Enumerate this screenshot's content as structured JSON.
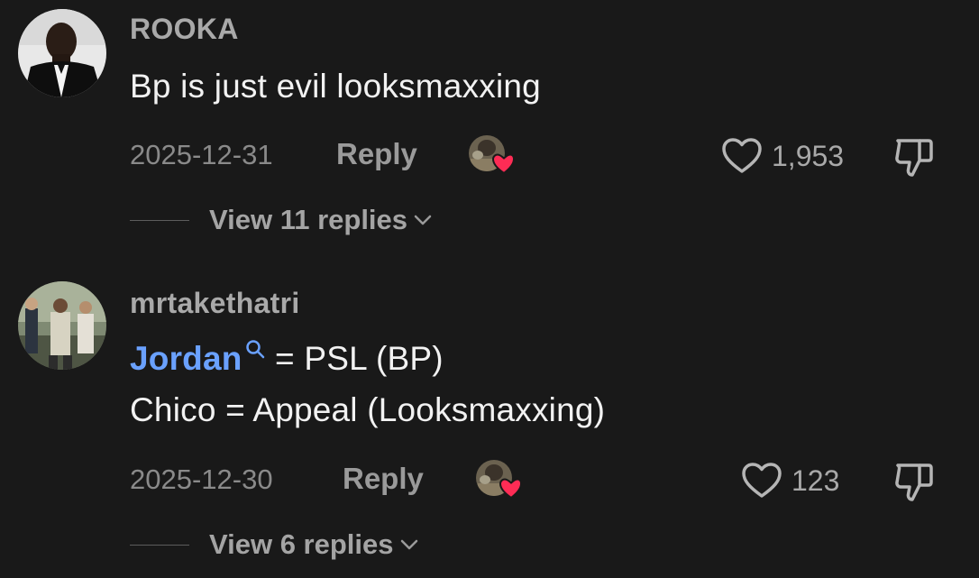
{
  "comments": [
    {
      "username": "ROOKA",
      "lines": [
        "Bp is just evil looksmaxxing"
      ],
      "date": "2025-12-31",
      "reply_label": "Reply",
      "likes": "1,953",
      "view_replies": "View 11 replies"
    },
    {
      "username": "mrtakethatri",
      "mention": "Jordan",
      "line1_rest": " = PSL (BP)",
      "line2": "Chico = Appeal (Looksmaxxing)",
      "date": "2025-12-30",
      "reply_label": "Reply",
      "likes": "123",
      "view_replies": "View 6 replies"
    }
  ],
  "colors": {
    "background": "#191919",
    "username": "#a9a9a9",
    "body_text": "#f2f2f2",
    "mention": "#6aa1ff",
    "meta": "#8a8a8a",
    "creator_heart": "#fe2c55"
  },
  "icons": {
    "like": "heart-outline-icon",
    "dislike": "thumbs-down-icon",
    "creator_liked": "creator-heart-badge-icon",
    "mention_search": "search-icon",
    "expand": "chevron-down-icon"
  }
}
